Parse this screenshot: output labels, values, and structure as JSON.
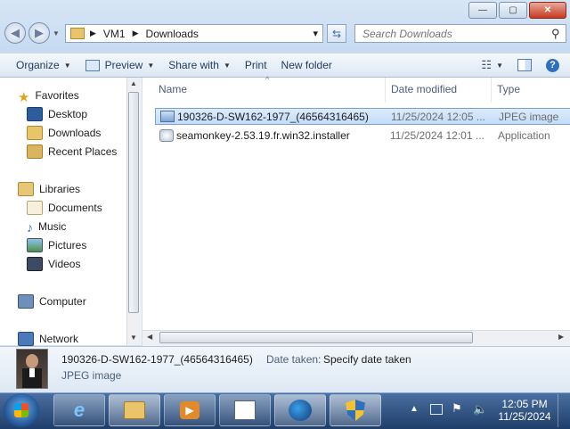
{
  "window": {
    "minimize_label": "—",
    "maximize_label": "▢",
    "close_label": "✕"
  },
  "address": {
    "segments": [
      "VM1",
      "Downloads"
    ],
    "dropdown_glyph": "▾"
  },
  "search": {
    "placeholder": "Search Downloads"
  },
  "toolbar": {
    "organize": "Organize",
    "preview": "Preview",
    "share_with": "Share with",
    "print": "Print",
    "new_folder": "New folder"
  },
  "nav": {
    "favorites": "Favorites",
    "desktop": "Desktop",
    "downloads": "Downloads",
    "recent_places": "Recent Places",
    "libraries": "Libraries",
    "documents": "Documents",
    "music": "Music",
    "pictures": "Pictures",
    "videos": "Videos",
    "computer": "Computer",
    "network": "Network"
  },
  "columns": {
    "name": "Name",
    "date_modified": "Date modified",
    "type": "Type"
  },
  "files": [
    {
      "name": "190326-D-SW162-1977_(46564316465)",
      "date": "11/25/2024 12:05 ...",
      "type": "JPEG image",
      "selected": true,
      "icon": "image-file-icon"
    },
    {
      "name": "seamonkey-2.53.19.fr.win32.installer",
      "date": "11/25/2024 12:01 ...",
      "type": "Application",
      "selected": false,
      "icon": "installer-icon"
    }
  ],
  "details": {
    "filename": "190326-D-SW162-1977_(46564316465)",
    "date_taken_label": "Date taken:",
    "date_taken_value": "Specify date taken",
    "file_type": "JPEG image"
  },
  "taskbar": {
    "time": "12:05 PM",
    "date": "11/25/2024"
  },
  "colors": {
    "accent": "#2f6fbf",
    "selection": "#c3dcf8",
    "taskbar": "#1f3e6a"
  }
}
